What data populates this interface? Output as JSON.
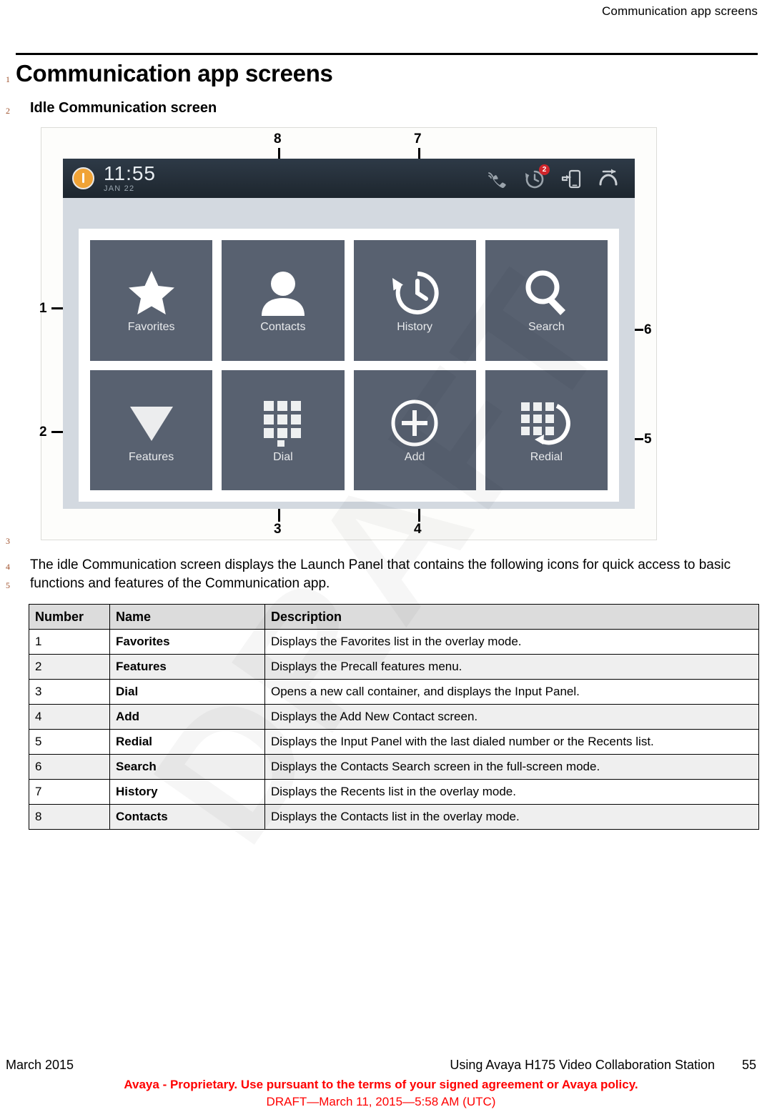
{
  "running_header": "Communication app screens",
  "chapter_title": "Communication app screens",
  "section_heading": "Idle Communication screen",
  "line_numbers": [
    "1",
    "2",
    "3",
    "4",
    "5"
  ],
  "watermark": "DRAFT",
  "figure": {
    "statusbar": {
      "time": "11:55",
      "date": "JAN 22",
      "alert_badge_icon": "exclamation-badge-icon",
      "icons": [
        {
          "name": "active-call-icon",
          "count": null
        },
        {
          "name": "missed-history-icon",
          "count": "2"
        },
        {
          "name": "send-to-device-icon",
          "count": null
        },
        {
          "name": "call-forward-icon",
          "count": null
        }
      ]
    },
    "tiles": [
      {
        "label": "Favorites",
        "icon": "star-icon"
      },
      {
        "label": "Contacts",
        "icon": "person-icon"
      },
      {
        "label": "History",
        "icon": "history-clock-icon"
      },
      {
        "label": "Search",
        "icon": "magnifier-icon"
      },
      {
        "label": "Features",
        "icon": "triangle-down-icon"
      },
      {
        "label": "Dial",
        "icon": "keypad-icon"
      },
      {
        "label": "Add",
        "icon": "plus-circle-icon"
      },
      {
        "label": "Redial",
        "icon": "redial-keypad-icon"
      }
    ],
    "callouts": [
      "1",
      "2",
      "3",
      "4",
      "5",
      "6",
      "7",
      "8"
    ]
  },
  "body_paragraph": "The idle Communication screen displays the Launch Panel that contains the following icons for quick access to basic functions and features of the Communication app.",
  "table": {
    "headers": [
      "Number",
      "Name",
      "Description"
    ],
    "rows": [
      {
        "number": "1",
        "name": "Favorites",
        "description": "Displays the Favorites list in the overlay mode."
      },
      {
        "number": "2",
        "name": "Features",
        "description": "Displays the Precall features menu."
      },
      {
        "number": "3",
        "name": "Dial",
        "description": "Opens a new call container, and displays the Input Panel."
      },
      {
        "number": "4",
        "name": "Add",
        "description": "Displays the Add New Contact screen."
      },
      {
        "number": "5",
        "name": "Redial",
        "description": "Displays the Input Panel with the last dialed number or the Recents list."
      },
      {
        "number": "6",
        "name": "Search",
        "description": "Displays the Contacts Search screen in the full-screen mode."
      },
      {
        "number": "7",
        "name": "History",
        "description": "Displays the Recents list in the overlay mode."
      },
      {
        "number": "8",
        "name": "Contacts",
        "description": "Displays the Contacts list in the overlay mode."
      }
    ]
  },
  "footer": {
    "date": "March 2015",
    "document_title": "Using Avaya H175 Video Collaboration Station",
    "page_number": "55",
    "proprietary_notice": "Avaya - Proprietary. Use pursuant to the terms of your signed agreement or Avaya policy.",
    "draft_notice": "DRAFT—March 11, 2015—5:58 AM (UTC)"
  },
  "colors": {
    "tile_bg": "#586170",
    "statusbar_bg": "#242e38",
    "panel_bg": "#d3d9e0",
    "badge_orange": "#f0a336",
    "badge_red": "#d0252b",
    "notice_red": "#ff0000",
    "linenum_brown": "#a0522d"
  }
}
